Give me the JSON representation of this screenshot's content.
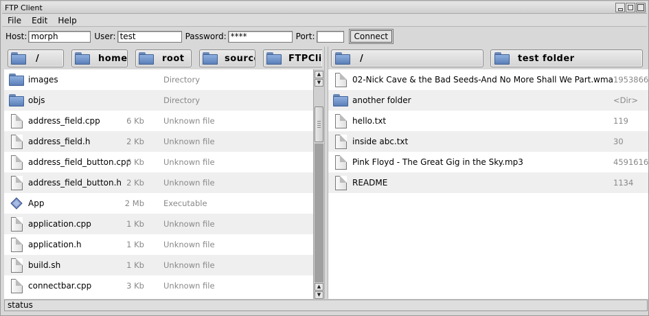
{
  "window": {
    "title": "FTP Client"
  },
  "menu": [
    "File",
    "Edit",
    "Help"
  ],
  "connection": {
    "host_label": "Host:",
    "host_value": "morph",
    "user_label": "User:",
    "user_value": "test",
    "password_label": "Password:",
    "password_value": "****",
    "port_label": "Port:",
    "port_value": "",
    "connect_label": "Connect"
  },
  "local": {
    "breadcrumbs": [
      "/",
      "home",
      "root",
      "source",
      "FTPClie"
    ],
    "files": [
      {
        "name": "images",
        "size": "",
        "type": "Directory",
        "icon": "folder-icon"
      },
      {
        "name": "objs",
        "size": "",
        "type": "Directory",
        "icon": "folder-icon"
      },
      {
        "name": "address_field.cpp",
        "size": "6 Kb",
        "type": "Unknown file",
        "icon": "file-icon"
      },
      {
        "name": "address_field.h",
        "size": "2 Kb",
        "type": "Unknown file",
        "icon": "file-icon"
      },
      {
        "name": "address_field_button.cpp",
        "size": "6 Kb",
        "type": "Unknown file",
        "icon": "file-icon"
      },
      {
        "name": "address_field_button.h",
        "size": "2 Kb",
        "type": "Unknown file",
        "icon": "file-icon"
      },
      {
        "name": "App",
        "size": "2 Mb",
        "type": "Executable",
        "icon": "executable-icon"
      },
      {
        "name": "application.cpp",
        "size": "1 Kb",
        "type": "Unknown file",
        "icon": "file-icon"
      },
      {
        "name": "application.h",
        "size": "1 Kb",
        "type": "Unknown file",
        "icon": "file-icon"
      },
      {
        "name": "build.sh",
        "size": "1 Kb",
        "type": "Unknown file",
        "icon": "file-icon"
      },
      {
        "name": "connectbar.cpp",
        "size": "3 Kb",
        "type": "Unknown file",
        "icon": "file-icon"
      }
    ]
  },
  "remote": {
    "breadcrumbs": [
      "/",
      "test folder"
    ],
    "files": [
      {
        "name": "02-Nick Cave & the Bad Seeds-And No More Shall We Part.wma",
        "size": "1953866",
        "icon": "file-icon"
      },
      {
        "name": "another folder",
        "size": "<Dir>",
        "icon": "folder-icon"
      },
      {
        "name": "hello.txt",
        "size": "119",
        "icon": "file-icon"
      },
      {
        "name": "inside abc.txt",
        "size": "30",
        "icon": "file-icon"
      },
      {
        "name": "Pink Floyd - The Great Gig in the Sky.mp3",
        "size": "4591616",
        "icon": "file-icon"
      },
      {
        "name": "README",
        "size": "1134",
        "icon": "file-icon"
      }
    ]
  },
  "status": {
    "text": "status"
  }
}
